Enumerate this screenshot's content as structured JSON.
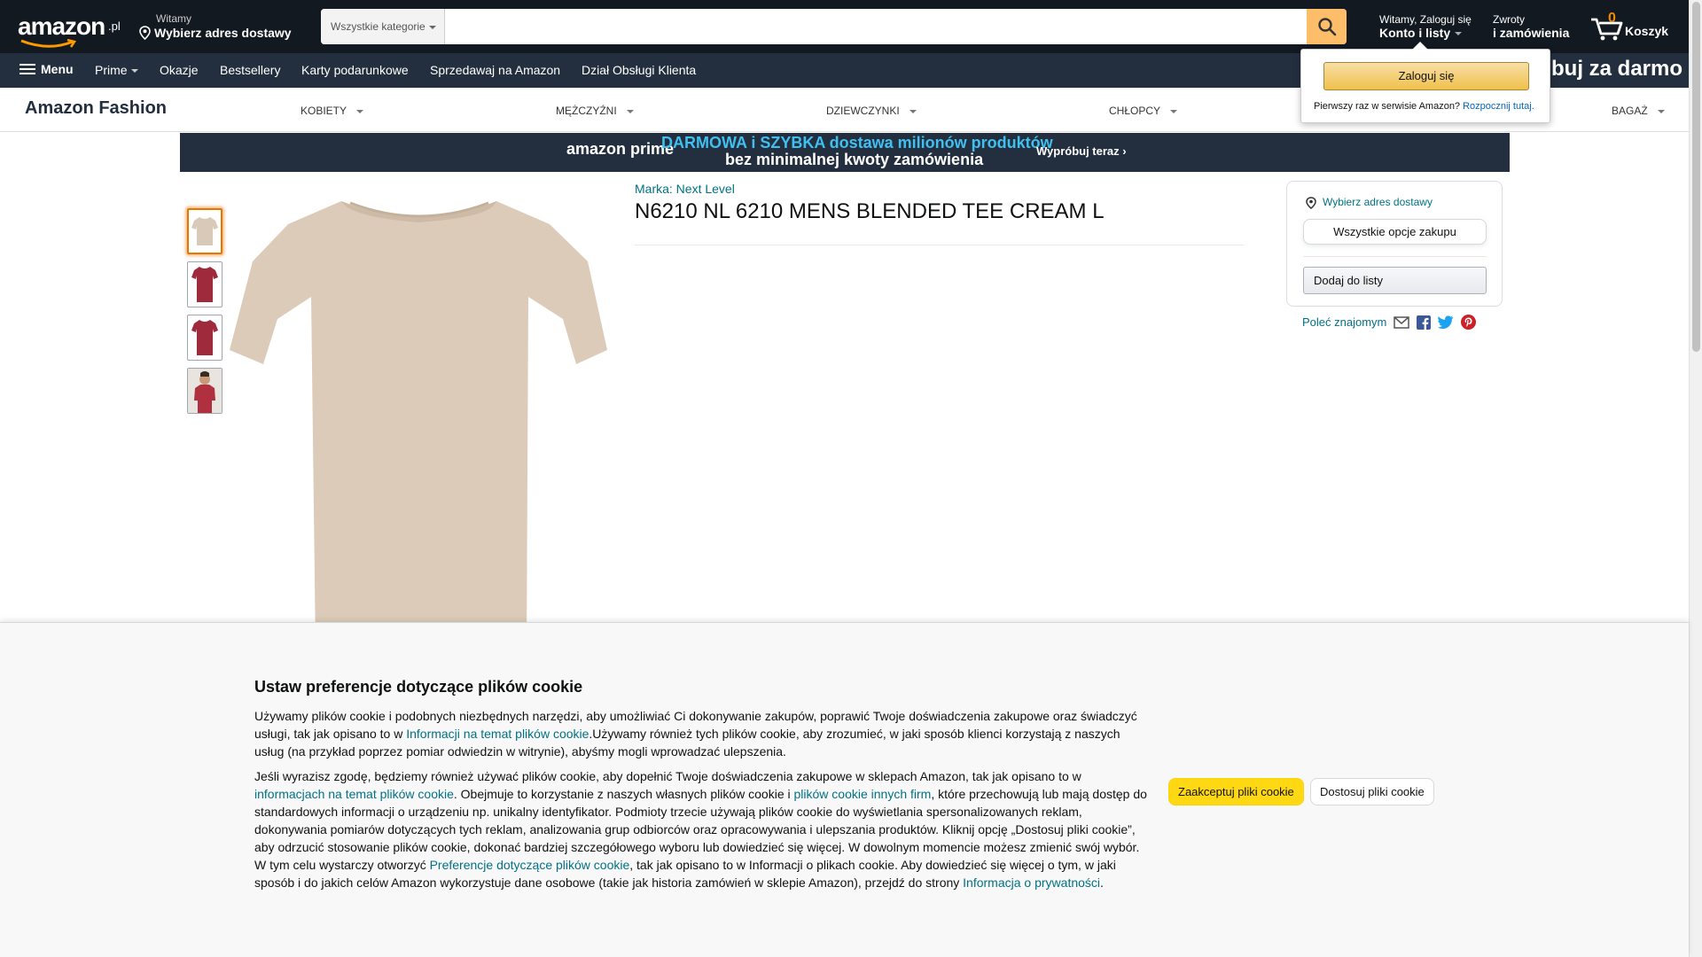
{
  "header": {
    "logo_text": "amazon",
    "logo_suffix": ".pl",
    "deliver_line1": "Witamy",
    "deliver_line2": "Wybierz adres dostawy",
    "search_category": "Wszystkie kategorie",
    "search_placeholder": "",
    "account_line1": "Witamy, Zaloguj się",
    "account_line2": "Konto i listy",
    "returns_line1": "Zwroty",
    "returns_line2": "i zamówienia",
    "cart_count": "0",
    "cart_label": "Koszyk"
  },
  "belt": {
    "menu_label": "Menu",
    "items": [
      "Prime",
      "Okazje",
      "Bestsellery",
      "Karty podarunkowe",
      "Sprzedawaj na Amazon",
      "Dział Obsługi Klienta"
    ],
    "promo": "buj za darmo"
  },
  "fashion_nav": {
    "brand": "Amazon Fashion",
    "categories": [
      "KOBIETY",
      "MĘŻCZYŹNI",
      "DZIEWCZYNKI",
      "CHŁOPCY",
      "BAGAŻ"
    ]
  },
  "prime_banner": {
    "logo": "amazon prime",
    "line1": "DARMOWA i SZYBKA dostawa milionów produktów",
    "line2": "bez minimalnej kwoty zamówienia",
    "cta": "Wypróbuj teraz ›"
  },
  "product": {
    "brand": "Marka: Next Level",
    "title": "N6210 NL 6210 MENS BLENDED TEE CREAM L",
    "thumb_colors": [
      "#d9c9b8",
      "#9e2a3b",
      "#9e2a3b",
      "#b03040"
    ],
    "main_color": "#dccbb9"
  },
  "buybox": {
    "deliver": "Wybierz adres dostawy",
    "all_options": "Wszystkie opcje zakupu",
    "add_to_list": "Dodaj do listy",
    "share_label": "Poleć znajomym"
  },
  "flyout": {
    "signin": "Zaloguj się",
    "new_customer": "Pierwszy raz w serwisie Amazon?",
    "start_here": "Rozpocznij tutaj."
  },
  "cookie": {
    "title": "Ustaw preferencje dotyczące plików cookie",
    "p1_a": "Używamy plików cookie i podobnych niezbędnych narzędzi, aby umożliwiać Ci dokonywanie zakupów, poprawić Twoje doświadczenia zakupowe oraz świadczyć usługi, tak jak opisano to w ",
    "p1_link": "Informacji na temat plików cookie",
    "p1_b": ".Używamy również tych plików cookie, aby zrozumieć, w jaki sposób klienci korzystają z naszych usług (na przykład poprzez pomiar odwiedzin w witrynie), abyśmy mogli wprowadzać ulepszenia.",
    "p2_a": "Jeśli wyrazisz zgodę, będziemy również używać plików cookie, aby dopełnić Twoje doświadczenia zakupowe w sklepach Amazon, tak jak opisano to w ",
    "p2_link1": "informacjach na temat plików cookie",
    "p2_b": ". Obejmuje to korzystanie z naszych własnych plików cookie i ",
    "p2_link2": "plików cookie innych firm",
    "p2_c": ", które przechowują lub mają dostęp do standardowych informacji o urządzeniu np. unikalny identyfikator. Podmioty trzecie używają plików cookie do wyświetlania spersonalizowanych reklam, dokonywania pomiarów dotyczących tych reklam, analizowania grup odbiorców oraz opracowywania i ulepszania produktów. Kliknij opcję „Dostosuj pliki cookie”, aby odrzucić stosowanie plików cookie, dokonać bardziej szczegółowego wyboru lub dowiedzieć się więcej. W dowolnym momencie możesz zmienić swój wybór. W tym celu wystarczy otworzyć ",
    "p2_link3": "Preferencje dotyczące plików cookie",
    "p2_d": ", tak jak opisano to w Informacji o plikach cookie. Aby dowiedzieć się więcej o tym, w jaki sposób i do jakich celów Amazon wykorzystuje dane osobowe (takie jak historia zamówień w sklepie Amazon), przejdź do strony ",
    "p2_link4": "Informacja o prywatności",
    "p2_e": ".",
    "accept": "Zaakceptuj pliki cookie",
    "customize": "Dostosuj pliki cookie"
  }
}
